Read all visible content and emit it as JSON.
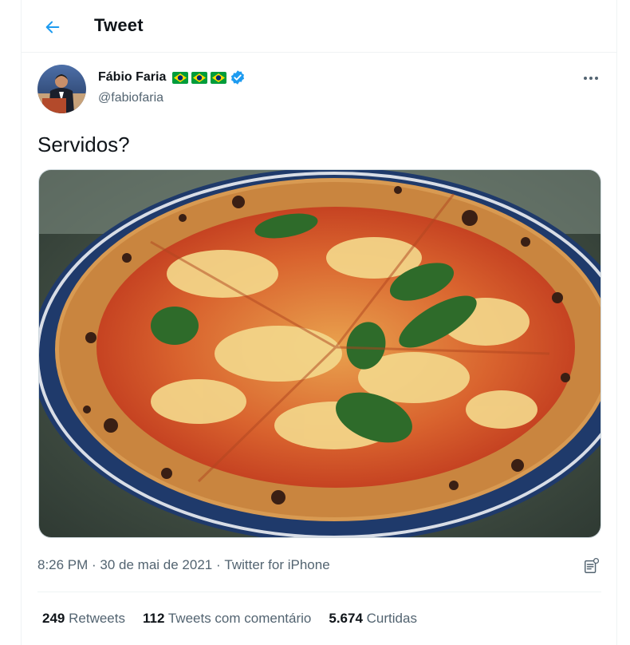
{
  "header": {
    "title": "Tweet"
  },
  "author": {
    "name": "Fábio Faria",
    "handle": "@fabiofaria",
    "flags": [
      "brazil-flag-icon",
      "brazil-flag-icon",
      "brazil-flag-icon"
    ],
    "verified": true
  },
  "tweet": {
    "text": "Servidos?",
    "time": "8:26 PM",
    "sep1": " · ",
    "date": "30 de mai de 2021",
    "sep2": " · ",
    "source": "Twitter for iPhone"
  },
  "stats": [
    {
      "count": "249",
      "label": "Retweets"
    },
    {
      "count": "112",
      "label": "Tweets com comentário"
    },
    {
      "count": "5.674",
      "label": "Curtidas"
    }
  ],
  "colors": {
    "accent": "#1d9bf0",
    "secondary_text": "#536471",
    "brazil_green": "#009c3b",
    "brazil_yellow": "#ffdf00",
    "brazil_blue": "#002776"
  }
}
